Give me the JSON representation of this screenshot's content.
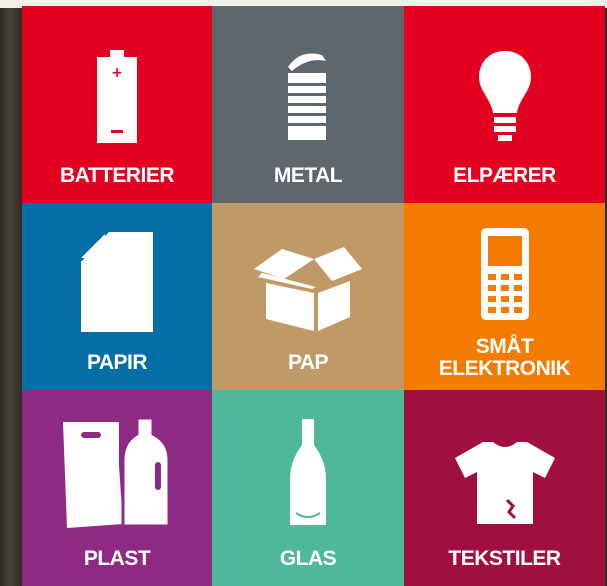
{
  "tiles": [
    {
      "label": "BATTERIER",
      "icon": "battery-icon",
      "color": "#e4001f"
    },
    {
      "label": "METAL",
      "icon": "tin-can-icon",
      "color": "#5e676e"
    },
    {
      "label": "ELPÆRER",
      "icon": "light-bulb-icon",
      "color": "#e4001f"
    },
    {
      "label": "PAPIR",
      "icon": "paper-sheet-icon",
      "color": "#046fa6"
    },
    {
      "label": "PAP",
      "icon": "cardboard-box-icon",
      "color": "#c09a66"
    },
    {
      "label": "SMÅT\nELEKTRONIK",
      "icon": "mobile-phone-icon",
      "color": "#f47a00"
    },
    {
      "label": "PLAST",
      "icon": "plastic-bag-bottle-icon",
      "color": "#8f2a84"
    },
    {
      "label": "GLAS",
      "icon": "glass-bottle-icon",
      "color": "#4db999"
    },
    {
      "label": "TEKSTILER",
      "icon": "t-shirt-icon",
      "color": "#a0103f"
    }
  ]
}
